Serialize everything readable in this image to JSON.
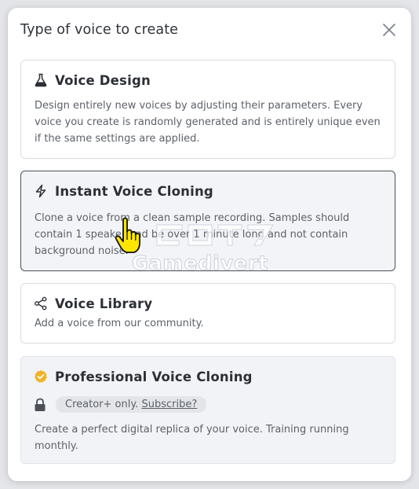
{
  "modal": {
    "title": "Type of voice to create"
  },
  "cards": [
    {
      "icon": "flask-icon",
      "title": "Voice Design",
      "description": "Design entirely new voices by adjusting their parameters. Every voice you create is randomly generated and is entirely unique even if the same settings are applied."
    },
    {
      "icon": "lightning-icon",
      "title": "Instant Voice Cloning",
      "description": "Clone a voice from a clean sample recording. Samples should contain 1 speaker and be over 1 minute long and not contain background noise."
    },
    {
      "icon": "share-icon",
      "title": "Voice Library",
      "description": "Add a voice from our community."
    },
    {
      "icon": "verified-badge-icon",
      "title": "Professional Voice Cloning",
      "badge_text": "Creator+ only.",
      "badge_link": "Subscribe?",
      "description": "Create a perfect digital replica of your voice. Training running monthly."
    }
  ],
  "watermark": {
    "text": "Gamedivert"
  },
  "colors": {
    "verified": "#f0b323",
    "active_border": "#4b5058",
    "text_primary": "#2c3036",
    "text_secondary": "#5c6169"
  }
}
